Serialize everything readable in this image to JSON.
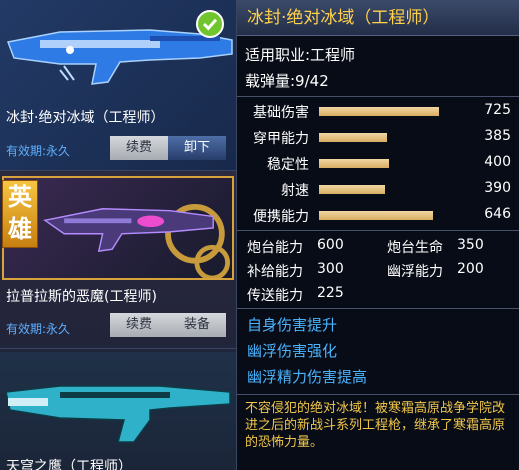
{
  "inventory": {
    "items": [
      {
        "name": "冰封·绝对冰域（工程师）",
        "expiry": "有效期:永久",
        "renew_label": "续费",
        "action_label": "卸下",
        "equipped": true,
        "accent": "#2f7be6"
      },
      {
        "name": "拉普拉斯的恶魔(工程师)",
        "expiry": "有效期:永久",
        "renew_label": "续费",
        "action_label": "装备",
        "badge": "英雄",
        "badge_color": "#e8a11c"
      },
      {
        "name": "天穹之鹰（工程师）",
        "accent": "#2fb2c9"
      }
    ]
  },
  "detail": {
    "title": "冰封·绝对冰域（工程师）",
    "job": "适用职业:工程师",
    "ammo": "载弹量:9/42",
    "stats": [
      {
        "label": "基础伤害",
        "value": 725,
        "fill": 0.92
      },
      {
        "label": "穿甲能力",
        "value": 385,
        "fill": 0.52
      },
      {
        "label": "稳定性",
        "value": 400,
        "fill": 0.54
      },
      {
        "label": "射速",
        "value": 390,
        "fill": 0.51
      },
      {
        "label": "便携能力",
        "value": 646,
        "fill": 0.88
      }
    ],
    "capabilities": [
      {
        "label": "炮台能力",
        "value": "600"
      },
      {
        "label": "炮台生命",
        "value": "350"
      },
      {
        "label": "补给能力",
        "value": "300"
      },
      {
        "label": "幽浮能力",
        "value": "200"
      },
      {
        "label": "传送能力",
        "value": "225"
      }
    ],
    "perks": [
      "自身伤害提升",
      "幽浮伤害强化",
      "幽浮精力伤害提高"
    ],
    "description": "不容侵犯的绝对冰域！被寒霜高原战争学院改进之后的新战斗系列工程枪，继承了寒霜高原的恐怖力量。"
  },
  "colors": {
    "title": "#ffd24a",
    "perk": "#4ab4ff",
    "description": "#f0c64a",
    "expiry": "#5fb0ff",
    "bar": "#e7c489"
  }
}
